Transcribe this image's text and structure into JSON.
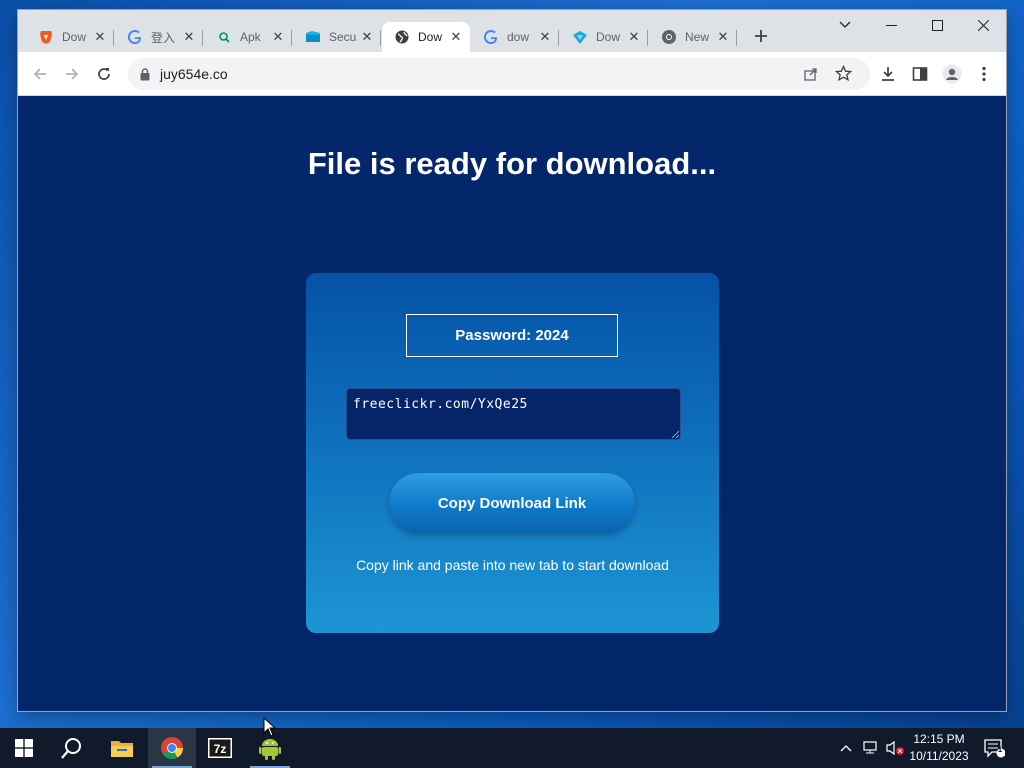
{
  "browser": {
    "tabs": [
      {
        "title": "Dow",
        "icon": "brave-shield-icon",
        "active": false
      },
      {
        "title": "登入",
        "icon": "google-icon",
        "active": false
      },
      {
        "title": "Apk",
        "icon": "apk-search-icon",
        "active": false
      },
      {
        "title": "Secu",
        "icon": "security-folder-icon",
        "active": false
      },
      {
        "title": "Dow",
        "icon": "globe-icon",
        "active": true
      },
      {
        "title": "dow",
        "icon": "google-icon",
        "active": false
      },
      {
        "title": "Dow",
        "icon": "download-diamond-icon",
        "active": false
      },
      {
        "title": "New",
        "icon": "chrome-icon",
        "active": false
      }
    ],
    "address": "juy654e.co"
  },
  "page": {
    "heading": "File is ready for download...",
    "password_label": "Password: 2024",
    "link_text": "freeclickr.com/YxQe25",
    "copy_button": "Copy Download Link",
    "hint": "Copy link and paste into new tab to start download"
  },
  "taskbar": {
    "apps": [
      "start",
      "search",
      "file-explorer",
      "chrome",
      "7zip",
      "android"
    ],
    "time": "12:15 PM",
    "date": "10/11/2023",
    "notification_count": "1"
  },
  "colors": {
    "page_bg": "#04276b",
    "card_top": "#0552a7",
    "card_bottom": "#1d95d3",
    "taskbar": "#101a2a"
  }
}
